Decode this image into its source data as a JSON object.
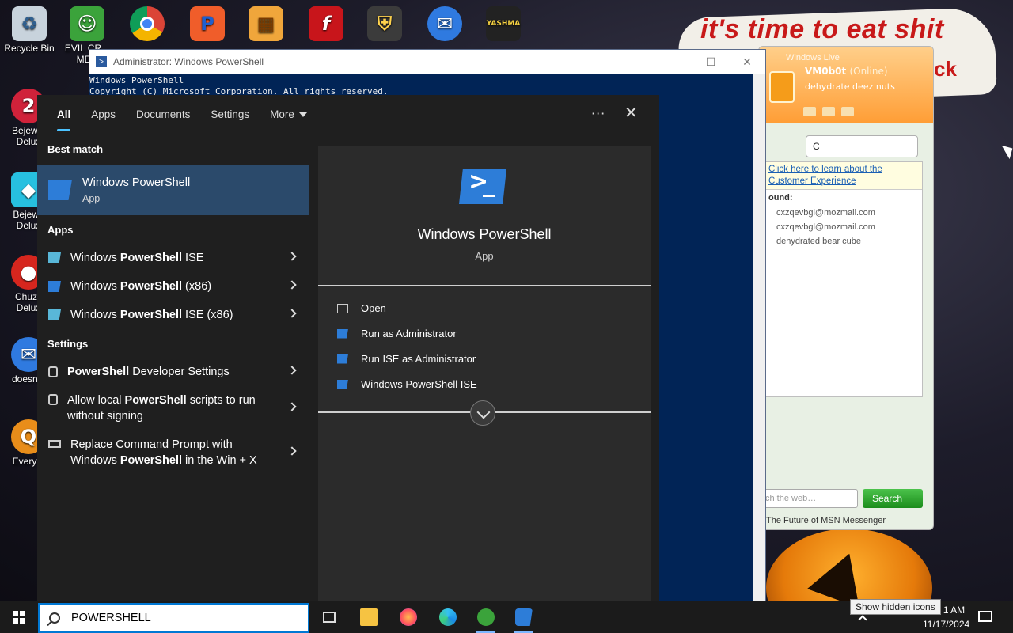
{
  "desktop": {
    "icons": [
      {
        "label": "Recycle Bin"
      },
      {
        "label": "EVIL CR...\nMEN"
      },
      {
        "label": "Bejewel\nDelux"
      },
      {
        "label": "Bejewe\nDelux"
      },
      {
        "label": "Chuzz\nDelux"
      },
      {
        "label": "doesnt l"
      },
      {
        "label": "Everyth"
      }
    ],
    "banner_line1": "it's time to eat shit",
    "banner_line2": "ck"
  },
  "powershell": {
    "title": "Administrator: Windows PowerShell",
    "lines": [
      "Windows PowerShell",
      "Copyright (C) Microsoft Corporation. All rights reserved."
    ],
    "minimize": "—",
    "maximize": "☐",
    "close": "✕"
  },
  "msn": {
    "brand": "Windows Live",
    "name": "VM0b0t",
    "status": "(Online)",
    "psm": "dehydrate deez nuts",
    "search_value": "C",
    "info_link": "Click here to learn about the Customer Experience",
    "found_label": "ound:",
    "contacts": [
      "cxzqevbgl@mozmail.com",
      "cxzqevbgl@mozmail.com",
      "dehydrated bear cube"
    ],
    "web_placeholder": "ch the web…",
    "search_button": "Search",
    "footer": "The Future of MSN Messenger"
  },
  "search_panel": {
    "tabs": [
      "All",
      "Apps",
      "Documents",
      "Settings",
      "More"
    ],
    "ellipsis": "···",
    "close": "✕",
    "best_match_header": "Best match",
    "best_match": {
      "name": "Windows PowerShell",
      "type": "App"
    },
    "apps_header": "Apps",
    "apps": [
      {
        "pre": "Windows ",
        "bold": "PowerShell",
        "post": " ISE"
      },
      {
        "pre": "Windows ",
        "bold": "PowerShell",
        "post": " (x86)"
      },
      {
        "pre": "Windows ",
        "bold": "PowerShell",
        "post": " ISE (x86)"
      }
    ],
    "settings_header": "Settings",
    "settings": [
      {
        "pre": "",
        "bold": "PowerShell",
        "post": " Developer Settings"
      },
      {
        "pre": "Allow local ",
        "bold": "PowerShell",
        "post": " scripts to run without signing"
      },
      {
        "pre": "Replace Command Prompt with Windows ",
        "bold": "PowerShell",
        "post": " in the Win + X"
      }
    ],
    "detail": {
      "name": "Windows PowerShell",
      "type": "App",
      "actions": [
        "Open",
        "Run as Administrator",
        "Run ISE as Administrator",
        "Windows PowerShell ISE"
      ]
    }
  },
  "taskbar": {
    "search_value": "POWERSHELL",
    "time": "1 AM",
    "date": "11/17/2024",
    "tooltip": "Show hidden icons"
  }
}
